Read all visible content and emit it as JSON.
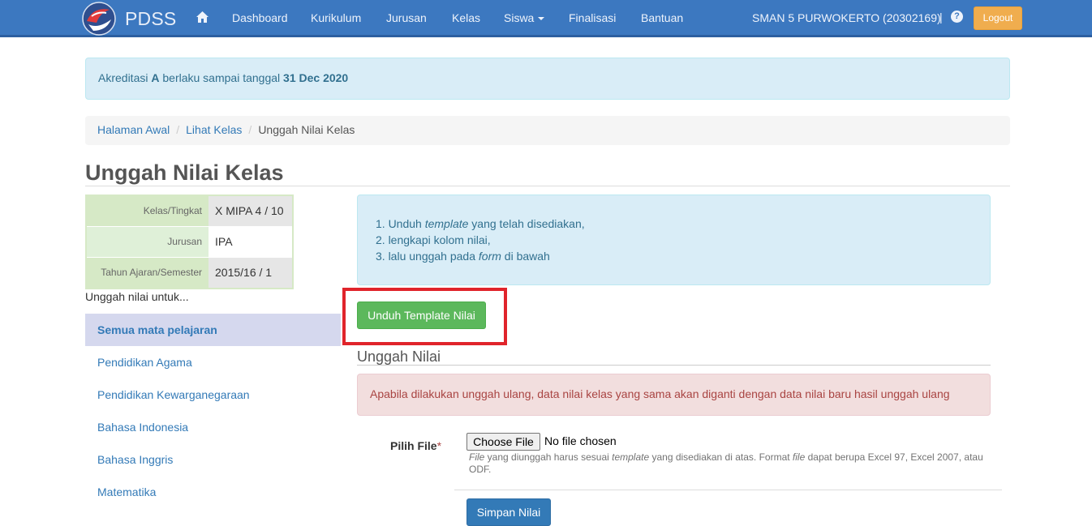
{
  "nav": {
    "brand": "PDSS",
    "items": [
      "Dashboard",
      "Kurikulum",
      "Jurusan",
      "Kelas",
      "Siswa",
      "Finalisasi",
      "Bantuan"
    ],
    "school": "SMAN 5 PURWOKERTO (20302169)",
    "separator": "|",
    "help": "?",
    "logout": "Logout"
  },
  "accreditation": {
    "prefix": "Akreditasi",
    "grade": "A",
    "middle": "berlaku sampai tanggal",
    "date": "31 Dec 2020"
  },
  "breadcrumb": {
    "home": "Halaman Awal",
    "classes": "Lihat Kelas",
    "current": "Unggah Nilai Kelas",
    "divider": "/"
  },
  "page_title": "Unggah Nilai Kelas",
  "class_info": [
    {
      "label": "Kelas/Tingkat",
      "value": "X MIPA 4 / 10"
    },
    {
      "label": "Jurusan",
      "value": "IPA"
    },
    {
      "label": "Tahun Ajaran/Semester",
      "value": "2015/16 / 1"
    }
  ],
  "upload_for": "Unggah nilai untuk...",
  "subjects": [
    "Semua mata pelajaran",
    "Pendidikan Agama",
    "Pendidikan Kewarganegaraan",
    "Bahasa Indonesia",
    "Bahasa Inggris",
    "Matematika"
  ],
  "steps": {
    "s1_a": "1. Unduh ",
    "s1_b": "template",
    "s1_c": " yang telah disediakan,",
    "s2": "2. lengkapi kolom nilai,",
    "s3_a": "3. lalu unggah pada ",
    "s3_b": "form",
    "s3_c": " di bawah"
  },
  "download_button": "Unduh Template Nilai",
  "upload_section": "Unggah Nilai",
  "warning": "Apabila dilakukan unggah ulang, data nilai kelas yang sama akan diganti dengan data nilai baru hasil unggah ulang",
  "file": {
    "label": "Pilih File",
    "required": "*",
    "button": "Choose File",
    "status": "No file chosen",
    "help_1": "File",
    "help_2": " yang diunggah harus sesuai ",
    "help_3": "template",
    "help_4": " yang disediakan di atas. Format ",
    "help_5": "file",
    "help_6": " dapat berupa Excel 97, Excel 2007, atau ODF."
  },
  "save_button": "Simpan Nilai",
  "colors": {
    "navbar": "#3c78c0",
    "highlight": "#e0242b",
    "green": "#5cb85c",
    "blue": "#337ab7"
  }
}
